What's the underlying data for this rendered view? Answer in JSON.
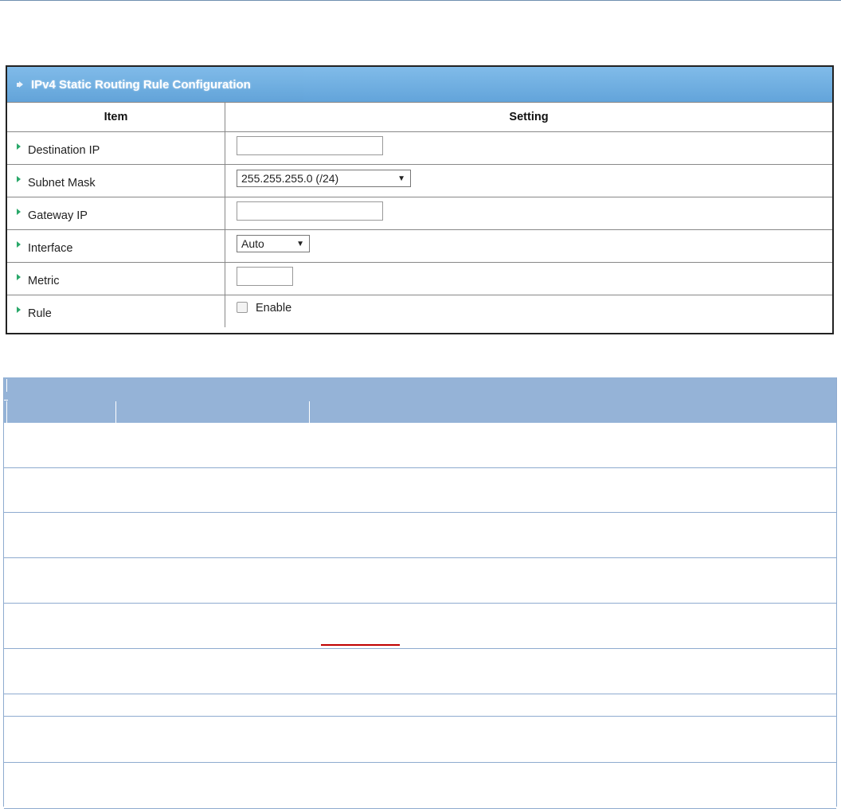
{
  "panel": {
    "title": "IPv4 Static Routing Rule Configuration",
    "col_item": "Item",
    "col_setting": "Setting",
    "rows": [
      {
        "label": "Destination IP",
        "value": ""
      },
      {
        "label": "Subnet Mask",
        "value": "255.255.255.0 (/24)"
      },
      {
        "label": "Gateway IP",
        "value": ""
      },
      {
        "label": "Interface",
        "value": "Auto"
      },
      {
        "label": "Metric",
        "value": ""
      },
      {
        "label": "Rule",
        "value": "Enable",
        "checked": false
      }
    ]
  },
  "colors": {
    "header_blue": "#5a9fd8",
    "desc_header": "#95b3d7",
    "row_border": "#8eabcf",
    "bullet_green": "#2aa86a",
    "link_red": "#c00000"
  }
}
